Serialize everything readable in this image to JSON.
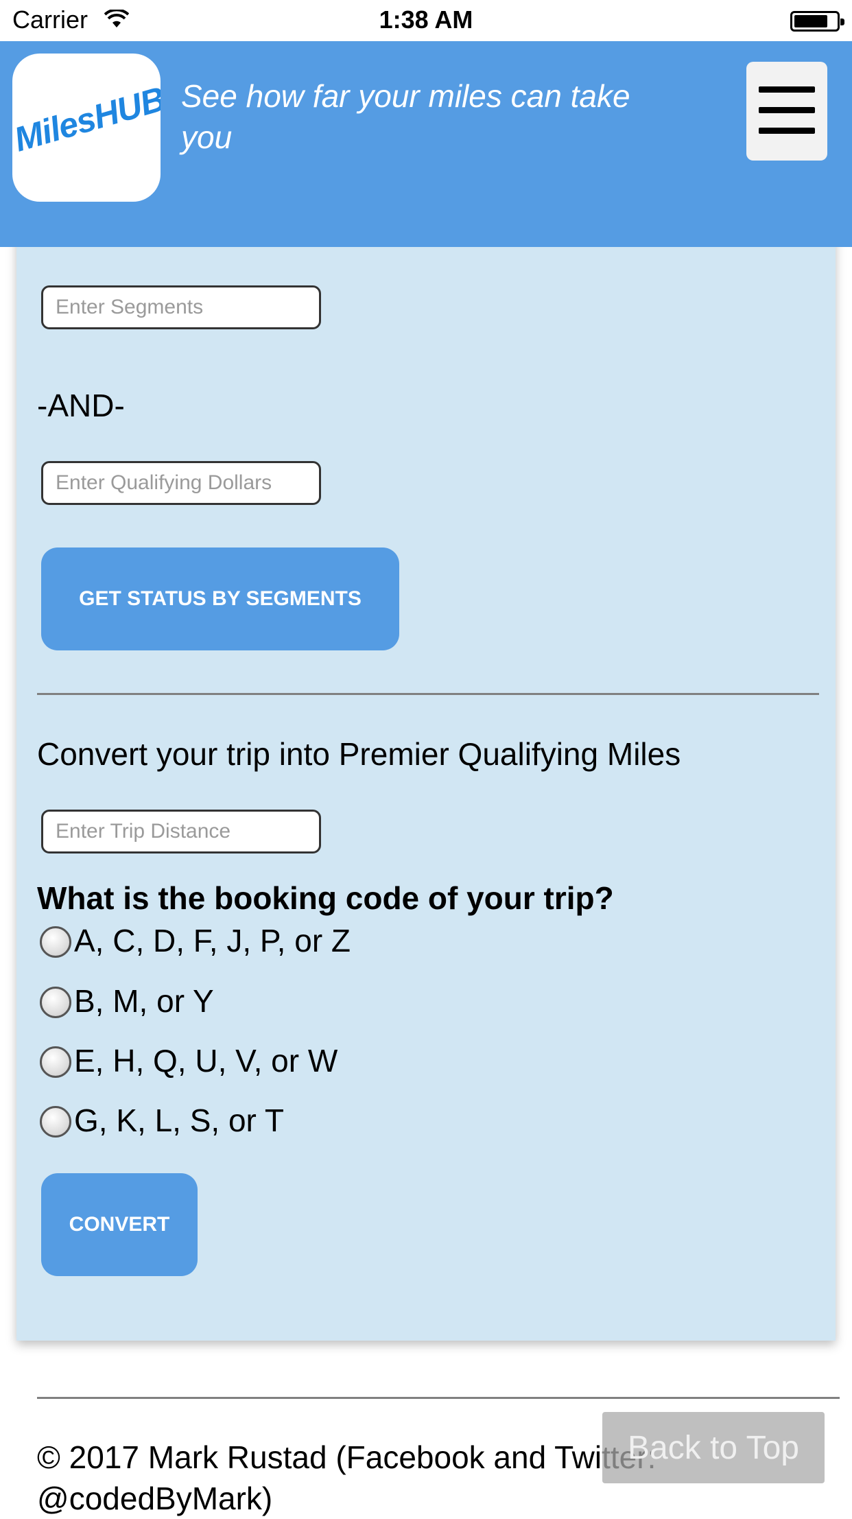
{
  "status_bar": {
    "carrier": "Carrier",
    "time": "1:38 AM"
  },
  "header": {
    "logo_text": "MilesHUB",
    "tagline": "See how far your miles can take you"
  },
  "segments_section": {
    "segments_placeholder": "Enter Segments",
    "and_label": "-AND-",
    "dollars_placeholder": "Enter Qualifying Dollars",
    "submit_label": "GET STATUS BY SEGMENTS"
  },
  "convert_section": {
    "heading": "Convert your trip into Premier Qualifying Miles",
    "distance_placeholder": "Enter Trip Distance",
    "question": "What is the booking code of your trip?",
    "options": [
      {
        "label": "A, C, D, F, J, P, or Z"
      },
      {
        "label": "B, M, or Y"
      },
      {
        "label": "E, H, Q, U, V, or W"
      },
      {
        "label": "G, K, L, S, or T"
      }
    ],
    "submit_label": "CONVERT"
  },
  "footer": {
    "copyright": "© 2017 Mark Rustad (Facebook and Twitter: @codedByMark)",
    "back_to_top": "Back to Top"
  },
  "colors": {
    "header_bg": "#559ce3",
    "panel_bg": "#d1e6f3",
    "button_bg": "#559ce3"
  }
}
